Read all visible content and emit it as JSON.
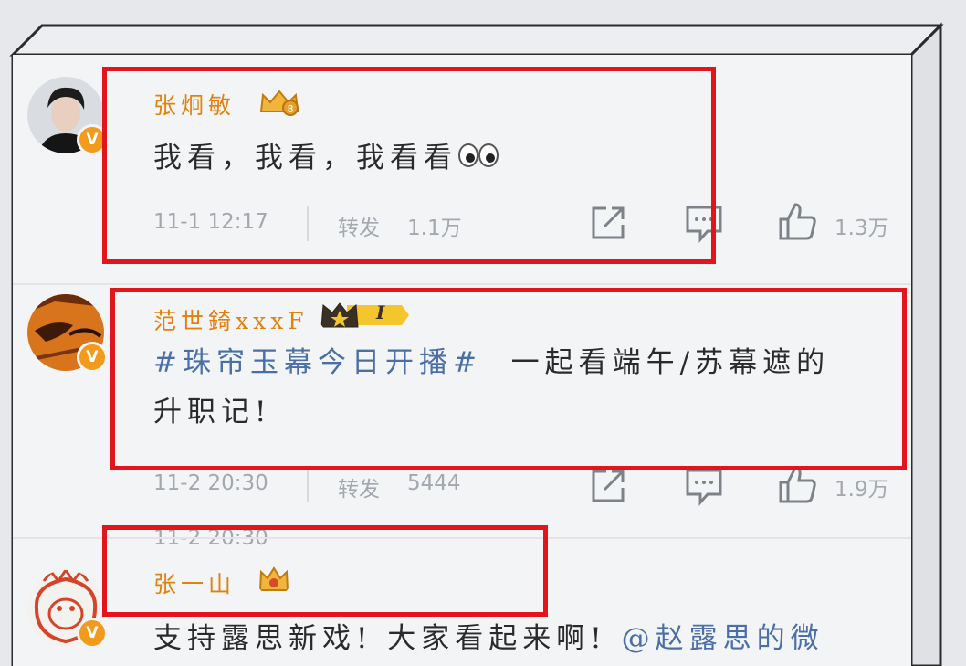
{
  "posts": [
    {
      "username": "张炯敏",
      "content": "我看，我看，我看看",
      "time": "11-1 12:17",
      "repost_label": "转发",
      "repost_count": "1.1万",
      "like_count": "1.3万"
    },
    {
      "username": "范世錡xxxF",
      "vip_level": "I",
      "hashtag": "#珠帘玉幕今日开播#",
      "content_line1": "一起看端午/苏幕遮的",
      "content_line2": "升职记!",
      "time": "11-2 20:30",
      "repost_label": "转发",
      "repost_count": "5444",
      "like_count": "1.9万"
    },
    {
      "username": "张一山",
      "content": "支持露思新戏! 大家看起来啊!",
      "mention": "@赵露思的微"
    }
  ],
  "colors": {
    "highlight_box": "#e2141c",
    "username": "#e0820f",
    "link": "#4a6fa5",
    "meta": "#a3a8ae"
  }
}
